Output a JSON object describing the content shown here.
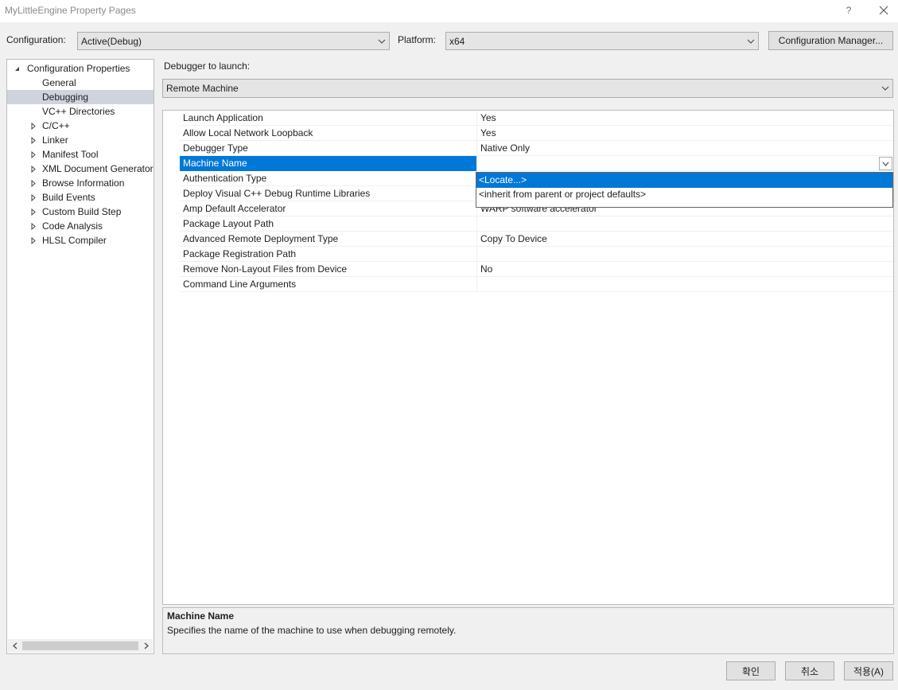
{
  "window": {
    "title": "MyLittleEngine Property Pages",
    "help_label": "?"
  },
  "toolbar": {
    "configuration_label": "Configuration:",
    "configuration_value": "Active(Debug)",
    "platform_label": "Platform:",
    "platform_value": "x64",
    "config_manager_label": "Configuration Manager..."
  },
  "tree": {
    "items": [
      {
        "label": "Configuration Properties",
        "expanded": true,
        "level": 0
      },
      {
        "label": "General",
        "level": 1
      },
      {
        "label": "Debugging",
        "level": 1,
        "selected": true
      },
      {
        "label": "VC++ Directories",
        "level": 1
      },
      {
        "label": "C/C++",
        "level": 1,
        "collapsed": true
      },
      {
        "label": "Linker",
        "level": 1,
        "collapsed": true
      },
      {
        "label": "Manifest Tool",
        "level": 1,
        "collapsed": true
      },
      {
        "label": "XML Document Generator",
        "level": 1,
        "collapsed": true
      },
      {
        "label": "Browse Information",
        "level": 1,
        "collapsed": true
      },
      {
        "label": "Build Events",
        "level": 1,
        "collapsed": true
      },
      {
        "label": "Custom Build Step",
        "level": 1,
        "collapsed": true
      },
      {
        "label": "Code Analysis",
        "level": 1,
        "collapsed": true
      },
      {
        "label": "HLSL Compiler",
        "level": 1,
        "collapsed": true
      }
    ]
  },
  "debugger": {
    "label": "Debugger to launch:",
    "value": "Remote Machine"
  },
  "grid": {
    "rows": [
      {
        "name": "Launch Application",
        "value": "Yes"
      },
      {
        "name": "Allow Local Network Loopback",
        "value": "Yes"
      },
      {
        "name": "Debugger Type",
        "value": "Native Only"
      },
      {
        "name": "Machine Name",
        "value": "",
        "selected": true
      },
      {
        "name": "Authentication Type",
        "value": ""
      },
      {
        "name": "Deploy Visual C++ Debug Runtime Libraries",
        "value": ""
      },
      {
        "name": "Amp Default Accelerator",
        "value": "WARP software accelerator"
      },
      {
        "name": "Package Layout Path",
        "value": ""
      },
      {
        "name": "Advanced Remote Deployment Type",
        "value": "Copy To Device"
      },
      {
        "name": "Package Registration Path",
        "value": ""
      },
      {
        "name": "Remove Non-Layout Files from Device",
        "value": "No"
      },
      {
        "name": "Command Line Arguments",
        "value": ""
      }
    ]
  },
  "dropdown": {
    "options": [
      "<Locate...>",
      "<inherit from parent or project defaults>"
    ]
  },
  "description": {
    "title": "Machine Name",
    "text": "Specifies the name of the machine to use when debugging remotely."
  },
  "buttons": {
    "ok": "확인",
    "cancel": "취소",
    "apply": "적용(A)"
  },
  "colors": {
    "selection": "#0078d7",
    "tree_selection": "#cfd3de"
  }
}
